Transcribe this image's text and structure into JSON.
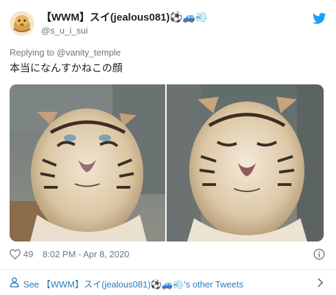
{
  "tweet": {
    "display_name": "【WWM】スイ(jealous081)⚽🚙💨",
    "handle": "@s_u_i_sui",
    "replying_prefix": "Replying to",
    "replying_to": "@vanity_temple",
    "text": "本当になんすかねこの顔",
    "likes": "49",
    "timestamp": "8:02 PM - Apr 8, 2020"
  },
  "footer": {
    "see_text": "See 【WWM】スイ(jealous081)⚽🚙💨's other Tweets"
  },
  "colors": {
    "twitter_blue": "#1da1f2",
    "link_blue": "#2b7bb9",
    "muted_gray": "#697882",
    "divider": "#e1e8ed"
  },
  "icons": [
    "avatar",
    "twitter-bird-icon",
    "heart-icon",
    "info-icon",
    "person-icon",
    "chevron-right-icon"
  ]
}
